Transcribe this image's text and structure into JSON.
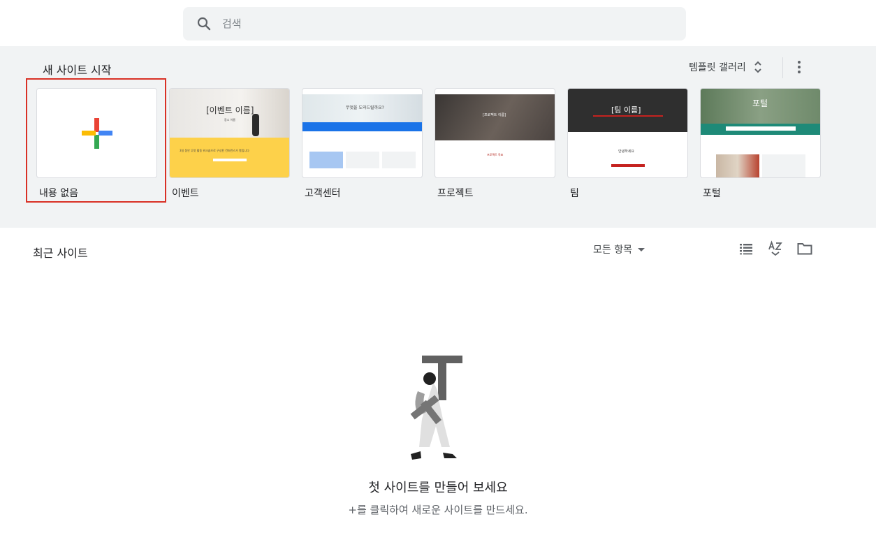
{
  "search": {
    "placeholder": "검색"
  },
  "templates": {
    "section_title": "새 사이트 시작",
    "gallery_label": "템플릿 갤러리",
    "cards": [
      {
        "label": "내용 없음",
        "thumb_title": ""
      },
      {
        "label": "이벤트",
        "thumb_title": "[이벤트 이름]",
        "thumb_sub": "장소 이름",
        "thumb_text": "3일 동안 무엇 활동 워크숍으로 구성된 컨퍼런스가 열립니다"
      },
      {
        "label": "고객센터",
        "thumb_title": "무엇을 도와드릴까요?"
      },
      {
        "label": "프로젝트",
        "thumb_title": "[프로젝트 이름]",
        "thumb_text": "프로젝트 목표"
      },
      {
        "label": "팀",
        "thumb_title": "[팀 이름]",
        "thumb_text": "안녕하세요"
      },
      {
        "label": "포털",
        "thumb_title": "포털"
      }
    ]
  },
  "recent": {
    "title": "최근 사이트",
    "owner_filter": "모든 항목"
  },
  "empty_state": {
    "title": "첫 사이트를 만들어 보세요",
    "subtitle": "+를 클릭하여 새로운 사이트를 만드세요."
  },
  "colors": {
    "google_red": "#ea4335",
    "google_blue": "#4285f4",
    "google_yellow": "#fbbc04",
    "google_green": "#34a853",
    "selection": "#d93025"
  }
}
